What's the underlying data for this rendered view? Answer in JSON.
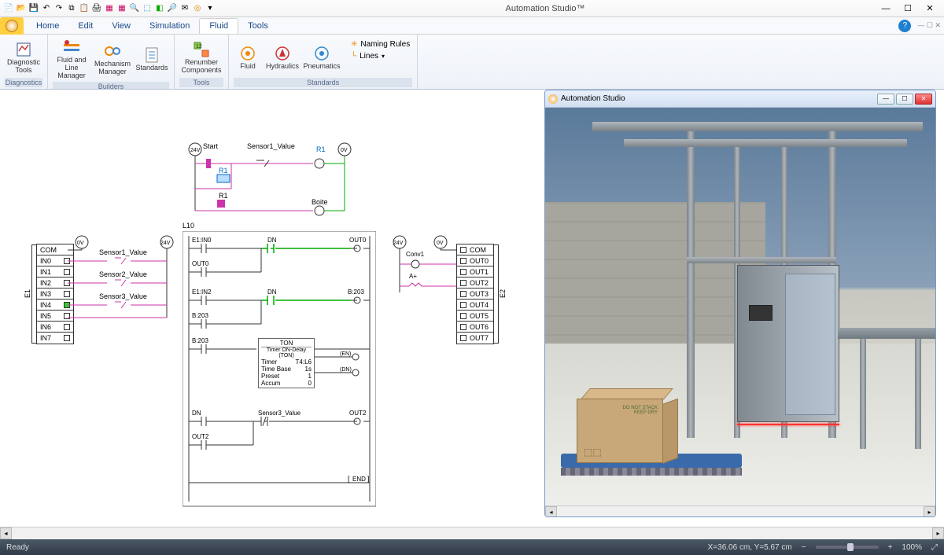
{
  "app": {
    "title": "Automation Studio™"
  },
  "qat_icons": [
    "file",
    "open",
    "save",
    "undo",
    "redo",
    "copy",
    "paste",
    "print",
    "i1",
    "i2",
    "i3",
    "i4",
    "zoom",
    "mail",
    "target",
    "grid"
  ],
  "tabs": [
    "Home",
    "Edit",
    "View",
    "Simulation",
    "Fluid",
    "Tools"
  ],
  "active_tab": 4,
  "ribbon": {
    "groups": [
      {
        "label": "Diagnostics",
        "items": [
          {
            "label": "Diagnostic Tools",
            "icon": "diagnostic"
          }
        ]
      },
      {
        "label": "Builders",
        "items": [
          {
            "label": "Fluid and Line Manager",
            "icon": "fluid-line"
          },
          {
            "label": "Mechanism Manager",
            "icon": "mechanism"
          },
          {
            "label": "Standards",
            "icon": "standards1"
          }
        ]
      },
      {
        "label": "Tools",
        "items": [
          {
            "label": "Renumber Components",
            "icon": "renumber"
          }
        ]
      },
      {
        "label": "Standards",
        "items": [
          {
            "label": "Fluid",
            "icon": "fluid-std"
          },
          {
            "label": "Hydraulics",
            "icon": "hydraulics"
          },
          {
            "label": "Pneumatics",
            "icon": "pneumatics"
          }
        ],
        "small": [
          {
            "label": "Naming Rules",
            "icon": "naming"
          },
          {
            "label": "Lines",
            "icon": "lines",
            "dropdown": true
          }
        ]
      }
    ]
  },
  "panel3d": {
    "title": "Automation Studio"
  },
  "diagram": {
    "voltage_24v": "24V",
    "voltage_0v": "0V",
    "start": "Start",
    "sensor1": "Sensor1_Value",
    "sensor2": "Sensor2_Value",
    "sensor3": "Sensor3_Value",
    "r1": "R1",
    "boite": "Boite",
    "l10": "L10",
    "e1in0": "E1:IN0",
    "e1in2": "E1:IN2",
    "dn": "DN",
    "out0": "OUT0",
    "out2": "OUT2",
    "b203": "B:203",
    "conv1": "Conv1",
    "a_plus": "A+",
    "end": "END",
    "ton": {
      "title": "TON",
      "subtitle": "Timer ON-Delay (TON)",
      "rows": [
        [
          "Timer",
          "T4:L6"
        ],
        [
          "Time Base",
          "1s"
        ],
        [
          "Preset",
          "1"
        ],
        [
          "Accum",
          "0"
        ]
      ]
    },
    "input_block": {
      "side": "E1",
      "rows": [
        "COM",
        "IN0",
        "IN1",
        "IN2",
        "IN3",
        "IN4",
        "IN5",
        "IN6",
        "IN7"
      ]
    },
    "output_block": {
      "side": "E2",
      "rows": [
        "COM",
        "OUT0",
        "OUT1",
        "OUT2",
        "OUT3",
        "OUT4",
        "OUT5",
        "OUT6",
        "OUT7"
      ]
    }
  },
  "statusbar": {
    "ready": "Ready",
    "coords": "X=36.06 cm, Y=5.67 cm",
    "zoom": "100%"
  }
}
